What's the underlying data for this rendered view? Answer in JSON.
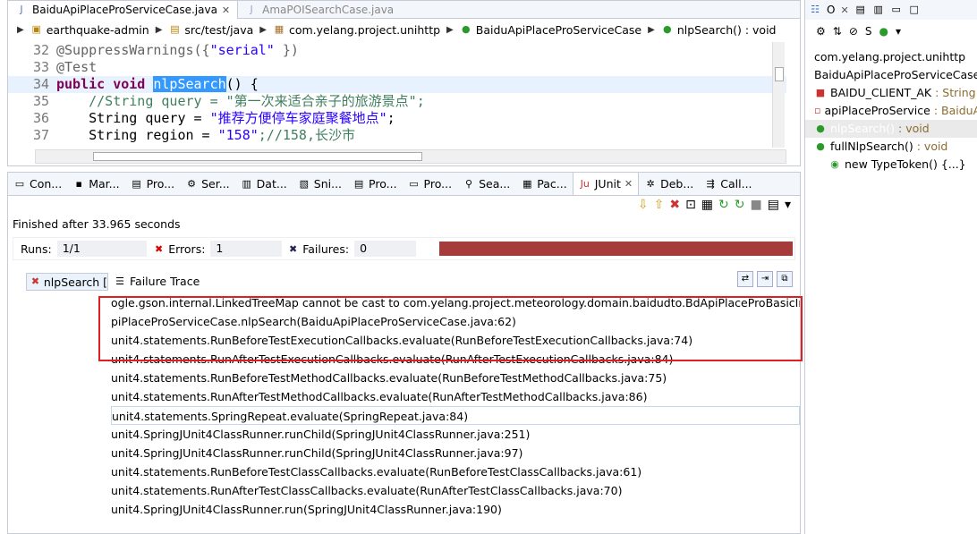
{
  "editor": {
    "tabs": [
      {
        "label": "BaiduApiPlaceProServiceCase.java",
        "active": true
      },
      {
        "label": "AmaPOISearchCase.java",
        "active": false
      }
    ],
    "breadcrumb": [
      "earthquake-admin",
      "src/test/java",
      "com.yelang.project.unihttp",
      "BaiduApiPlaceProServiceCase",
      "nlpSearch() : void"
    ],
    "lines": [
      {
        "num": "32",
        "annotation": "@SuppressWarnings({",
        "string": "\"serial\"",
        "tail": " })"
      },
      {
        "num": "33",
        "text": "@Test"
      },
      {
        "num": "34",
        "kw": "public void ",
        "sel": "nlpSearch",
        "tail": "() {"
      },
      {
        "num": "35",
        "comment": "    //String query = \"第一次来适合亲子的旅游景点\";"
      },
      {
        "num": "36",
        "pre": "    String query = ",
        "string": "\"推荐方便停车家庭聚餐地点\"",
        "tail": ";"
      },
      {
        "num": "37",
        "pre": "    String region = ",
        "string": "\"158\"",
        "comment": ";//158,长沙市"
      }
    ]
  },
  "panel": {
    "tabs": [
      "Con...",
      "Mar...",
      "Pro...",
      "Ser...",
      "Dat...",
      "Sni...",
      "Pro...",
      "Pro...",
      "Sea...",
      "Pac...",
      "JUnit",
      "Deb...",
      "Call..."
    ],
    "active_tab": "JUnit",
    "finished": "Finished after 33.965 seconds",
    "runs_label": "Runs:",
    "runs_value": "1/1",
    "errors_label": "Errors:",
    "errors_value": "1",
    "failures_label": "Failures:",
    "failures_value": "0",
    "progress_fraction": 1.0,
    "progress_color": "#a53b3b",
    "test_item": "nlpSearch [",
    "failure_trace_label": "Failure Trace",
    "trace": [
      "ogle.gson.internal.LinkedTreeMap cannot be cast to com.yelang.project.meteorology.domain.baidudto.BdApiPlaceProBasicInfoDTO",
      "piPlaceProServiceCase.nlpSearch(BaiduApiPlaceProServiceCase.java:62)",
      "unit4.statements.RunBeforeTestExecutionCallbacks.evaluate(RunBeforeTestExecutionCallbacks.java:74)",
      "unit4.statements.RunAfterTestExecutionCallbacks.evaluate(RunAfterTestExecutionCallbacks.java:84)",
      "unit4.statements.RunBeforeTestMethodCallbacks.evaluate(RunBeforeTestMethodCallbacks.java:75)",
      "unit4.statements.RunAfterTestMethodCallbacks.evaluate(RunAfterTestMethodCallbacks.java:86)",
      "unit4.statements.SpringRepeat.evaluate(SpringRepeat.java:84)",
      "unit4.SpringJUnit4ClassRunner.runChild(SpringJUnit4ClassRunner.java:251)",
      "unit4.SpringJUnit4ClassRunner.runChild(SpringJUnit4ClassRunner.java:97)",
      "unit4.statements.RunBeforeTestClassCallbacks.evaluate(RunBeforeTestClassCallbacks.java:61)",
      "unit4.statements.RunAfterTestClassCallbacks.evaluate(RunAfterTestClassCallbacks.java:70)",
      "unit4.SpringJUnit4ClassRunner.run(SpringJUnit4ClassRunner.java:190)"
    ]
  },
  "outline": {
    "tab_label": "O",
    "items": [
      {
        "text": "com.yelang.project.unihttp",
        "type": ""
      },
      {
        "text": "BaiduApiPlaceProServiceCase",
        "type": ""
      },
      {
        "text": "BAIDU_CLIENT_AK",
        "type": " : String"
      },
      {
        "text": "apiPlaceProService",
        "type": " : BaiduAp"
      },
      {
        "text": "nlpSearch()",
        "type": " : void"
      },
      {
        "text": "fullNlpSearch()",
        "type": " : void"
      },
      {
        "text": "new TypeToken() {...}",
        "type": ""
      }
    ]
  }
}
